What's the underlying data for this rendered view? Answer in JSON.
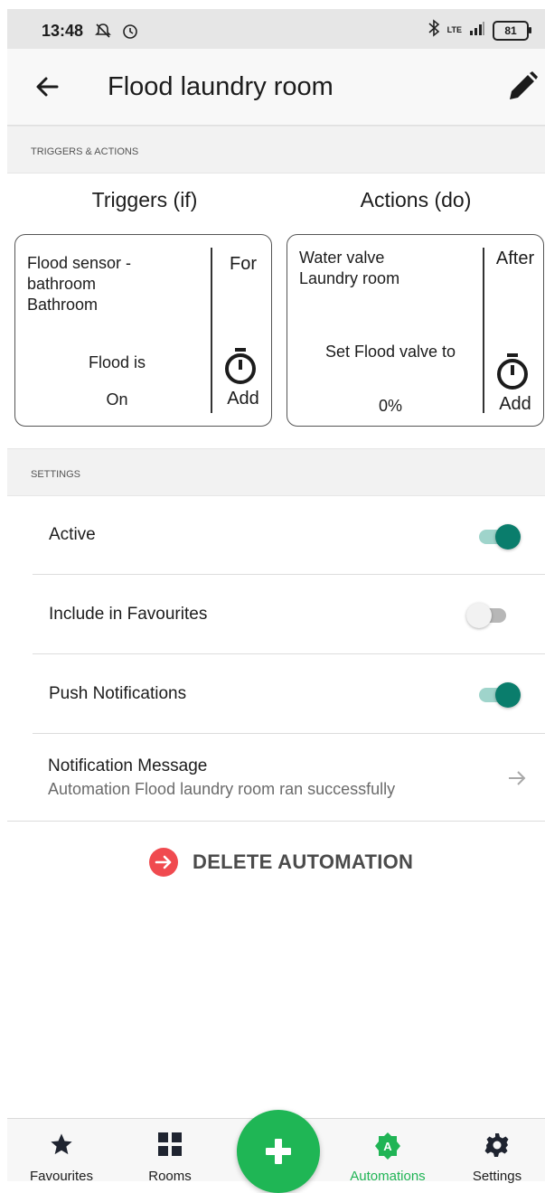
{
  "status_bar": {
    "time": "13:48",
    "network": "LTE",
    "battery": "81"
  },
  "app_bar": {
    "title": "Flood laundry room"
  },
  "sections": {
    "triggers_actions": "TRIGGERS & ACTIONS",
    "settings": "SETTINGS"
  },
  "triggers": {
    "heading": "Triggers (if)",
    "card": {
      "device_name": "Flood sensor -\nbathroom",
      "room": "Bathroom",
      "condition": "Flood is",
      "value": "On",
      "side_label": "For",
      "add_label": "Add"
    }
  },
  "actions": {
    "heading": "Actions (do)",
    "card": {
      "device_name": "Water valve",
      "room": "Laundry room",
      "action": "Set Flood valve to",
      "value": "0%",
      "side_label": "After",
      "add_label": "Add"
    }
  },
  "settings": {
    "active": {
      "label": "Active",
      "on": true
    },
    "favourites": {
      "label": "Include in Favourites",
      "on": false
    },
    "push": {
      "label": "Push Notifications",
      "on": true
    },
    "notification": {
      "label": "Notification Message",
      "value": "Automation Flood laundry room ran successfully"
    }
  },
  "delete_label": "DELETE AUTOMATION",
  "bottom_nav": {
    "favourites": "Favourites",
    "rooms": "Rooms",
    "automations": "Automations",
    "settings": "Settings"
  },
  "colors": {
    "accent_teal": "#0a7d6c",
    "fab_green": "#1fb655",
    "delete_red": "#f04a4f"
  }
}
